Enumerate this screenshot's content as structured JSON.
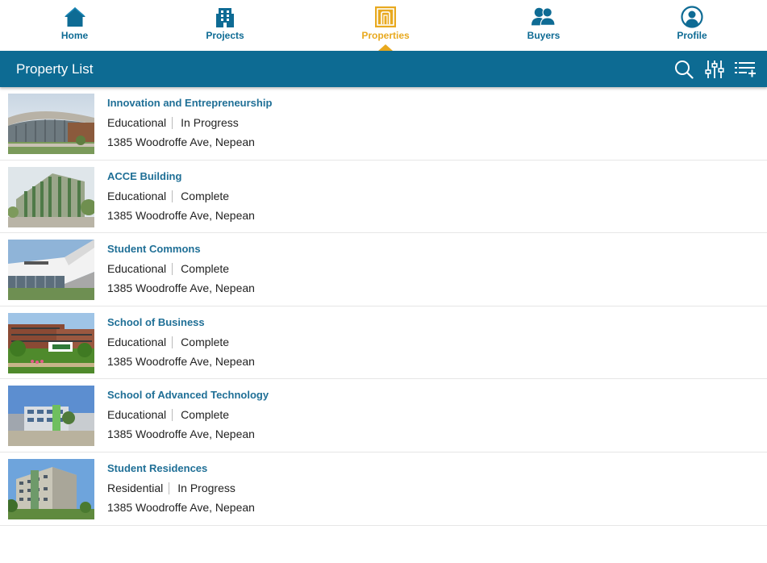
{
  "nav": {
    "items": [
      {
        "label": "Home",
        "icon": "home-icon"
      },
      {
        "label": "Projects",
        "icon": "building-icon"
      },
      {
        "label": "Properties",
        "icon": "property-icon"
      },
      {
        "label": "Buyers",
        "icon": "people-icon"
      },
      {
        "label": "Profile",
        "icon": "user-circle-icon"
      }
    ],
    "active": "Properties",
    "color": "#0e6b94",
    "active_color": "#e8a91f"
  },
  "header": {
    "title": "Property List",
    "background": "#0d6b93",
    "actions": [
      "search-icon",
      "filter-sliders-icon",
      "add-list-icon"
    ]
  },
  "properties": [
    {
      "name": "Innovation and Entrepreneurship",
      "category": "Educational",
      "status": "In Progress",
      "address": "1385 Woodroffe Ave, Nepean"
    },
    {
      "name": "ACCE Building",
      "category": "Educational",
      "status": "Complete",
      "address": "1385 Woodroffe Ave, Nepean"
    },
    {
      "name": "Student Commons",
      "category": "Educational",
      "status": "Complete",
      "address": "1385 Woodroffe Ave, Nepean"
    },
    {
      "name": "School of Business",
      "category": "Educational",
      "status": "Complete",
      "address": "1385 Woodroffe Ave, Nepean"
    },
    {
      "name": "School of Advanced Technology",
      "category": "Educational",
      "status": "Complete",
      "address": "1385 Woodroffe Ave, Nepean"
    },
    {
      "name": "Student Residences",
      "category": "Residential",
      "status": "In Progress",
      "address": "1385 Woodroffe Ave, Nepean"
    }
  ]
}
